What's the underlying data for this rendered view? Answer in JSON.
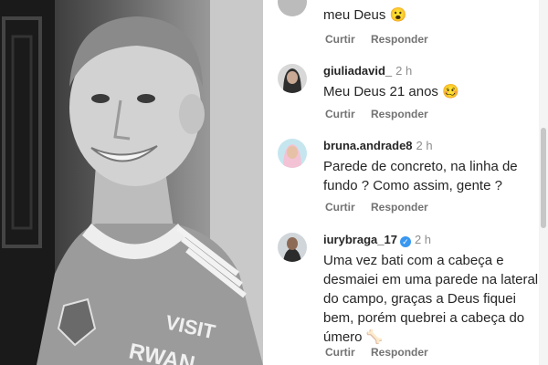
{
  "photo": {
    "alt": "Jogador em foto preto e branco",
    "sponsor_line1": "VISIT",
    "sponsor_line2": "RWAN"
  },
  "comments": [
    {
      "username": "",
      "time": "",
      "text": "meu Deus",
      "emoji": "😮",
      "reply_label": "Curtir",
      "respond_label": "Responder"
    },
    {
      "username": "giuliadavid_",
      "time": "2 h",
      "text": "Meu Deus 21 anos",
      "emoji": "🥴",
      "reply_label": "Curtir",
      "respond_label": "Responder"
    },
    {
      "username": "bruna.andrade8",
      "time": "2 h",
      "text_line1": "Parede de concreto, na linha de",
      "text_line2": "fundo ? Como assim, gente ?",
      "reply_label": "Curtir",
      "respond_label": "Responder"
    },
    {
      "username": "iurybraga_17",
      "verified": true,
      "time": "2 h",
      "text_line1": "Uma vez bati com a cabeça e",
      "text_line2": "desmaiei em uma parede na lateral",
      "text_line3": "do campo, graças a Deus fiquei",
      "text_line4": "bem, porém quebrei a cabeça do",
      "text_line5": "úmero",
      "emoji": "🦴",
      "reply_label": "Curtir",
      "respond_label": "Responder"
    }
  ],
  "icons": {
    "like": "heart-outline-icon",
    "verified": "verified-badge-icon"
  },
  "colors": {
    "username": "#262626",
    "meta": "#737373",
    "verified": "#3897f0"
  }
}
